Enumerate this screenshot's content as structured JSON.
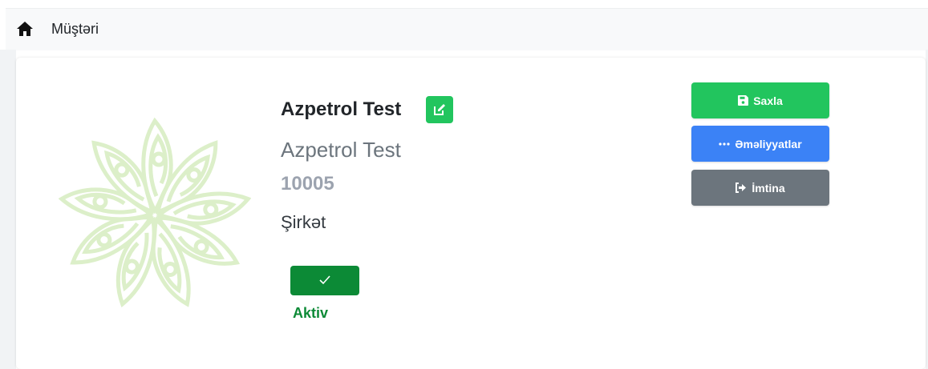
{
  "breadcrumb": {
    "icon": "home-icon",
    "label": "Müştəri"
  },
  "company": {
    "title": "Azpetrol Test",
    "subtitle": "Azpetrol Test",
    "code": "10005",
    "type": "Şirkət",
    "logo_icon": "azpetrol-flower-logo-icon",
    "edit_icon": "edit-icon"
  },
  "status": {
    "label": "Aktiv",
    "icon": "check-icon",
    "color": "#0c8a36"
  },
  "actions": {
    "save": {
      "label": "Saxla",
      "icon": "floppy-disk-icon",
      "color": "#22c55e"
    },
    "operations": {
      "label": "Əməliyyatlar",
      "icon": "ellipsis-icon",
      "color": "#3b82f6"
    },
    "cancel": {
      "label": "İmtina",
      "icon": "sign-out-icon",
      "color": "#6c757d"
    }
  }
}
